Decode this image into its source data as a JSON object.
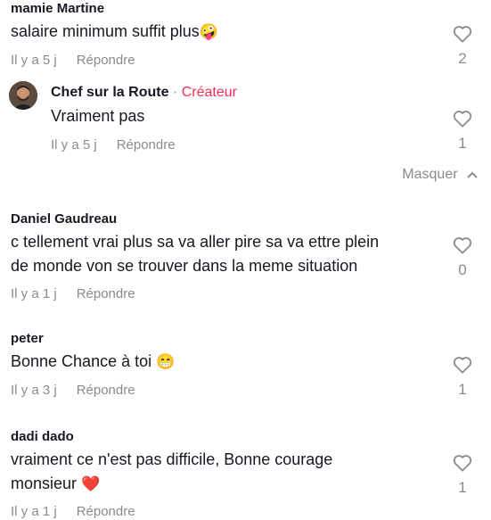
{
  "comments": [
    {
      "author": "mamie Martine",
      "text": "salaire minimum suffit plus",
      "emoji": "🤪",
      "time": "Il y a 5 j",
      "reply": "Répondre",
      "likes": "2"
    },
    {
      "author": "Daniel Gaudreau",
      "text_line1": "c tellement vrai plus sa va aller pire sa va ettre plein",
      "text_line2": "de monde von se trouver dans la meme situation",
      "time": "Il y a 1 j",
      "reply": "Répondre",
      "likes": "0"
    },
    {
      "author": "peter",
      "text": "Bonne Chance à toi",
      "emoji": "😁",
      "time": "Il y a 3 j",
      "reply": "Répondre",
      "likes": "1"
    },
    {
      "author": "dadi dado",
      "text_line1": "vraiment ce n'est pas difficile, Bonne courage",
      "text_line2": "monsieur",
      "emoji": "❤️",
      "time": "Il y a 1 j",
      "reply": "Répondre",
      "likes": "1"
    }
  ],
  "reply_thread": {
    "author": "Chef sur la Route",
    "separator": "·",
    "creator_label": "Créateur",
    "text": "Vraiment pas",
    "time": "Il y a 5 j",
    "reply": "Répondre",
    "likes": "1"
  },
  "hide_replies": {
    "label": "Masquer",
    "icon": "chevron-up-icon"
  },
  "icons": {
    "like": "heart-outline-icon"
  },
  "colors": {
    "creator": "#fe2c55",
    "muted": "#8a8b91",
    "text": "#161823"
  }
}
